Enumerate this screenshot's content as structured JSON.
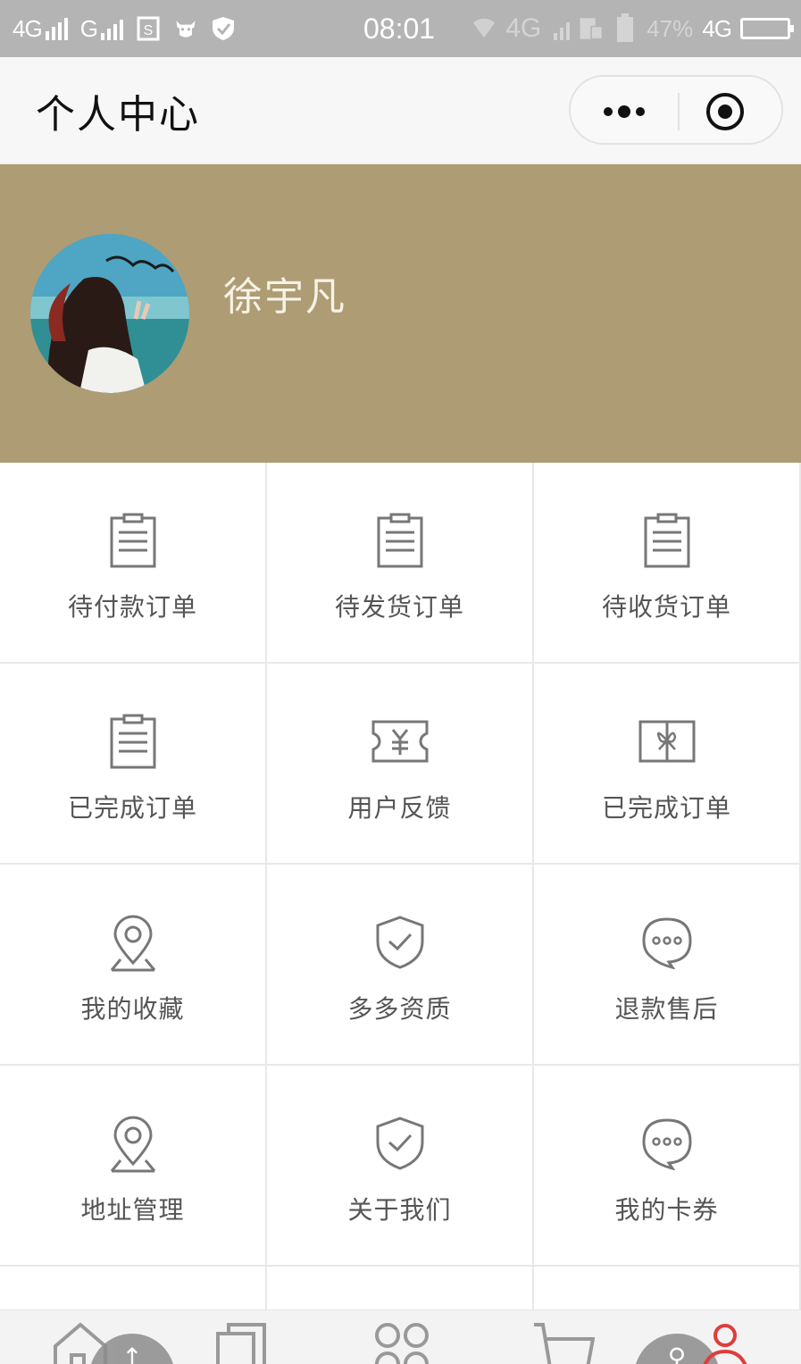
{
  "status_bar": {
    "network_1": "4G",
    "network_2": "G",
    "time": "08:01",
    "ghost_network": "4G",
    "battery_percent": "47%",
    "network_3": "4G"
  },
  "header": {
    "title": "个人中心"
  },
  "profile": {
    "username": "徐宇凡"
  },
  "menu": {
    "items": [
      {
        "label": "待付款订单",
        "icon": "clipboard-icon"
      },
      {
        "label": "待发货订单",
        "icon": "clipboard-icon"
      },
      {
        "label": "待收货订单",
        "icon": "clipboard-icon"
      },
      {
        "label": "已完成订单",
        "icon": "clipboard-icon"
      },
      {
        "label": "用户反馈",
        "icon": "ticket-icon"
      },
      {
        "label": "已完成订单",
        "icon": "gift-icon"
      },
      {
        "label": "我的收藏",
        "icon": "location-pin-icon"
      },
      {
        "label": "多多资质",
        "icon": "shield-check-icon"
      },
      {
        "label": "退款售后",
        "icon": "chat-bubble-icon"
      },
      {
        "label": "地址管理",
        "icon": "location-pin-icon"
      },
      {
        "label": "关于我们",
        "icon": "shield-check-icon"
      },
      {
        "label": "我的卡券",
        "icon": "chat-bubble-icon"
      }
    ]
  },
  "tab_bar": {
    "tabs": [
      "home-icon",
      "copy-icon",
      "grid-icon",
      "cart-icon",
      "user-icon"
    ],
    "active_color": "#e03c3c"
  },
  "colors": {
    "banner": "#ae9c74",
    "status_bar": "#b4b4b4"
  }
}
